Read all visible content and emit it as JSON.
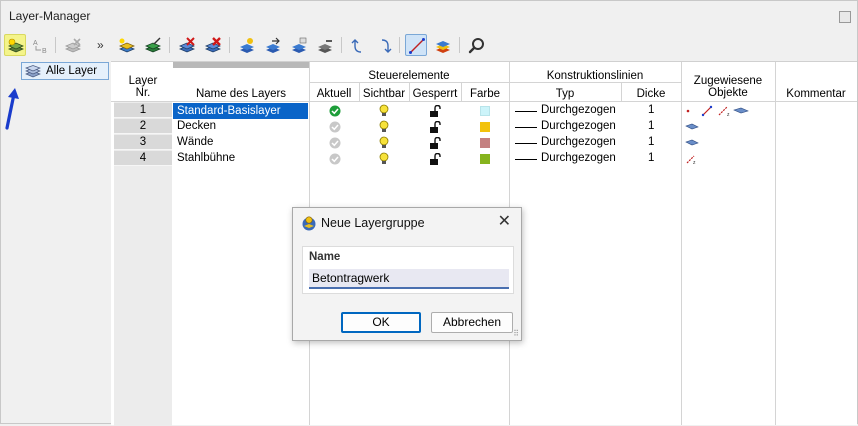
{
  "window": {
    "title": "Layer-Manager"
  },
  "left": {
    "overflow_label": "»",
    "tree_item": "Alle Layer"
  },
  "table": {
    "headers": {
      "layer_nr_line1": "Layer",
      "layer_nr_line2": "Nr.",
      "name": "Name des Layers",
      "steuer_group": "Steuerelemente",
      "aktuell": "Aktuell",
      "sichtbar": "Sichtbar",
      "gesperrt": "Gesperrt",
      "farbe": "Farbe",
      "konst_group": "Konstruktionslinien",
      "typ": "Typ",
      "dicke": "Dicke",
      "zugew_line1": "Zugewiesene",
      "zugew_line2": "Objekte",
      "kommentar": "Kommentar"
    },
    "rows": [
      {
        "nr": "1",
        "name": "Standard-Basislayer",
        "aktuell": "active",
        "color": "#ccf4fa",
        "typ": "Durchgezogen",
        "dicke": "1",
        "objects": [
          "point",
          "line",
          "dimension",
          "surface"
        ]
      },
      {
        "nr": "2",
        "name": "Decken",
        "aktuell": "inactive",
        "color": "#f2c20c",
        "typ": "Durchgezogen",
        "dicke": "1",
        "objects": [
          "surface"
        ]
      },
      {
        "nr": "3",
        "name": "Wände",
        "aktuell": "inactive",
        "color": "#c48080",
        "typ": "Durchgezogen",
        "dicke": "1",
        "objects": [
          "surface"
        ]
      },
      {
        "nr": "4",
        "name": "Stahlbühne",
        "aktuell": "inactive",
        "color": "#86b41e",
        "typ": "Durchgezogen",
        "dicke": "1",
        "objects": [
          "dimension"
        ]
      }
    ]
  },
  "dialog": {
    "title": "Neue Layergruppe",
    "close": "✕",
    "name_label": "Name",
    "name_value": "Betontragwerk",
    "ok": "OK",
    "cancel": "Abbrechen"
  },
  "colors": {
    "selection": "#0a64c8",
    "highlight_yellow": "#f4f48a",
    "annotation_arrow": "#1a3ccc"
  }
}
